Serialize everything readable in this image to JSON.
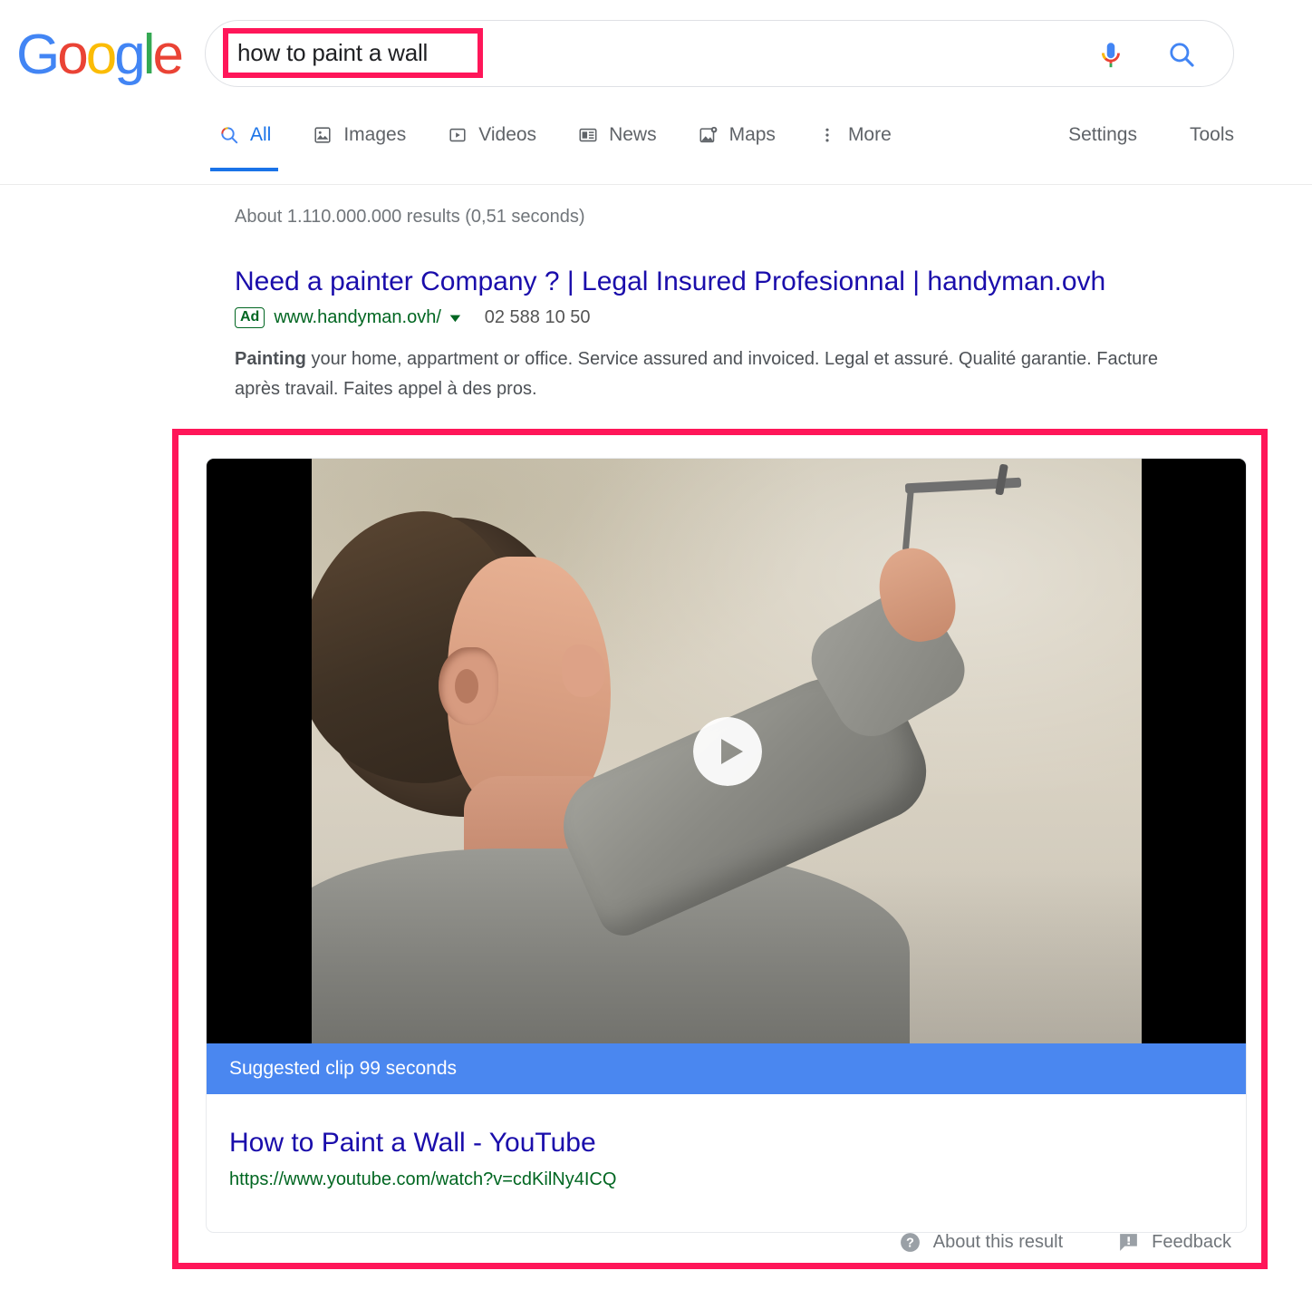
{
  "brand": {
    "logo_letters": [
      {
        "ch": "G",
        "color": "#4285F4"
      },
      {
        "ch": "o",
        "color": "#EA4335"
      },
      {
        "ch": "o",
        "color": "#FBBC05"
      },
      {
        "ch": "g",
        "color": "#4285F4"
      },
      {
        "ch": "l",
        "color": "#34A853"
      },
      {
        "ch": "e",
        "color": "#EA4335"
      }
    ],
    "name": "Google"
  },
  "search": {
    "query": "how to paint a wall",
    "placeholder": "Search",
    "mic_label": "Search by voice",
    "search_label": "Google Search",
    "highlight_color": "#ff1659"
  },
  "nav": {
    "tabs": [
      {
        "label": "All",
        "icon": "search-icon",
        "active": true
      },
      {
        "label": "Images",
        "icon": "image-icon",
        "active": false
      },
      {
        "label": "Videos",
        "icon": "video-icon",
        "active": false
      },
      {
        "label": "News",
        "icon": "news-icon",
        "active": false
      },
      {
        "label": "Maps",
        "icon": "map-pin-icon",
        "active": false
      },
      {
        "label": "More",
        "icon": "overflow-dots-icon",
        "active": false
      }
    ],
    "right": [
      {
        "label": "Settings"
      },
      {
        "label": "Tools"
      }
    ]
  },
  "results": {
    "count_text": "About 1.110.000.000 results (0,51 seconds)",
    "ad": {
      "title": "Need a painter Company ? | Legal Insured Profesionnal | handyman.ovh",
      "badge": "Ad",
      "url": "www.handyman.ovh/",
      "phone": "02 588 10 50",
      "desc_bold": "Painting",
      "desc_rest": " your home, appartment or office. Service assured and invoiced. Legal et assuré. Qualité garantie. Facture après travail. Faites appel à des pros."
    },
    "video": {
      "clip_banner": "Suggested clip 99 seconds",
      "title": "How to Paint a Wall - YouTube",
      "url": "https://www.youtube.com/watch?v=cdKilNy4ICQ",
      "banner_color": "#4a87f0",
      "play_label": "Play video",
      "footer": [
        {
          "label": "About this result",
          "icon": "question-circle-icon"
        },
        {
          "label": "Feedback",
          "icon": "feedback-flag-icon"
        }
      ]
    }
  }
}
